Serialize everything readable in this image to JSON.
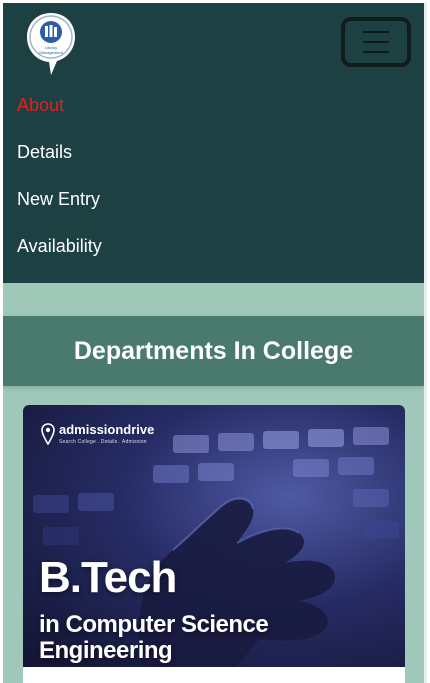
{
  "navbar": {
    "logo": {
      "icon": "library-books-icon",
      "text_line_1": "Library",
      "text_line_2": "Management"
    },
    "toggler_icon": "hamburger-menu-icon",
    "links": [
      {
        "label": "About",
        "active": true
      },
      {
        "label": "Details",
        "active": false
      },
      {
        "label": "New Entry",
        "active": false
      },
      {
        "label": "Availability",
        "active": false
      }
    ]
  },
  "section": {
    "title": "Departments In College"
  },
  "card": {
    "image": {
      "brand": "admissiondrive",
      "brand_tagline": "Search College . Details . Admission",
      "brand_icon": "location-pin-icon",
      "title": "B.Tech",
      "subtitle": "in Computer Science Engineering"
    }
  },
  "colors": {
    "navbar_bg": "#1d4142",
    "page_bg": "#9fc8b8",
    "section_header_bg": "#4a7a6e",
    "active_link": "#e51e1e",
    "link": "#ffffff"
  }
}
